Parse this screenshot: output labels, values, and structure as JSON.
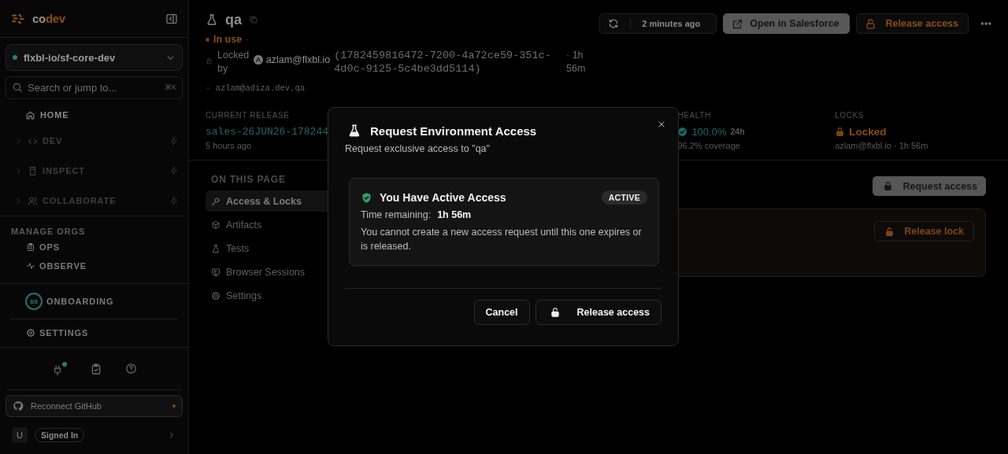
{
  "sidebar": {
    "logo_parts": [
      "co",
      "dev"
    ],
    "org_selector": {
      "label": "flxbl-io/sf-core-dev"
    },
    "search": {
      "placeholder": "Search or jump to...",
      "shortcut": "⌘K"
    },
    "nav": [
      {
        "kind": "link",
        "label": "HOME",
        "disabled": false
      },
      {
        "kind": "group",
        "label": "DEV",
        "disabled": true
      },
      {
        "kind": "group",
        "label": "INSPECT",
        "disabled": true
      },
      {
        "kind": "group",
        "label": "COLLABORATE",
        "disabled": true
      }
    ],
    "manage_orgs": {
      "title": "MANAGE ORGS",
      "items": [
        {
          "label": "OPS"
        },
        {
          "label": "OBSERVE"
        }
      ]
    },
    "onboarding": {
      "progress": "8/8",
      "level": 1,
      "label": "ONBOARDING"
    },
    "settings": {
      "label": "SETTINGS"
    },
    "reconnect": {
      "label": "Reconnect GitHub"
    },
    "user": {
      "initial": "U",
      "status": "Signed In"
    }
  },
  "header": {
    "title": "qa",
    "status": "In use",
    "separator": "·",
    "locked_by_label": "Locked by",
    "locker_initial": "A",
    "locker": "azlam@flxbl.io",
    "session": "(1782459816472-7200-4a72ce59-351c-4d0c-9125-5c4be3dd5114)",
    "duration": "· 1h 56m",
    "host": "· azlam@adiza.dev.qa"
  },
  "toolbar": {
    "sync_time": "2 minutes ago",
    "open_button": "Open in Salesforce",
    "release_button": "Release access"
  },
  "stats": [
    {
      "kind": "release",
      "label": "CURRENT RELEASE",
      "value": "sales-26JUN26-178244",
      "detail": "5 hours ago"
    },
    {
      "kind": "health",
      "label": "HEALTH",
      "value": "100.0%",
      "window": "24h",
      "detail": "96.2% coverage"
    },
    {
      "kind": "locks",
      "label": "LOCKS",
      "value": "Locked",
      "detail": "azlam@flxbl.io · 1h 56m"
    }
  ],
  "page_nav": {
    "title": "ON THIS PAGE",
    "items": [
      {
        "label": "Access & Locks",
        "selected": true
      },
      {
        "label": "Artifacts",
        "selected": false
      },
      {
        "label": "Tests",
        "selected": false
      },
      {
        "label": "Browser Sessions",
        "selected": false
      },
      {
        "label": "Settings",
        "selected": false
      }
    ]
  },
  "access_section": {
    "request_button": "Request access",
    "release_lock_button": "Release lock"
  },
  "dialog": {
    "title": "Request Environment Access",
    "subtitle": "Request exclusive access to \"qa\"",
    "card": {
      "title": "You Have Active Access",
      "badge": "ACTIVE",
      "time_label": "Time remaining:",
      "time_value": "1h 56m",
      "message": "You cannot create a new access request until this one expires or is released."
    },
    "buttons": [
      {
        "kind": "cancel",
        "label": "Cancel"
      },
      {
        "kind": "release",
        "label": "Release access"
      }
    ]
  }
}
